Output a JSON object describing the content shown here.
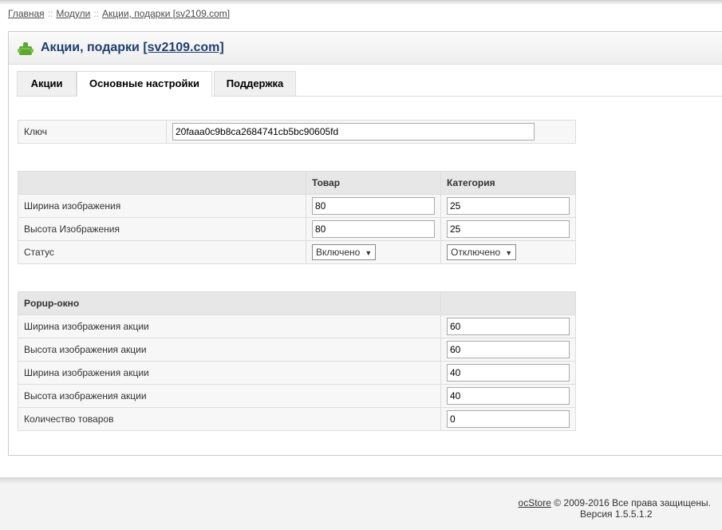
{
  "breadcrumb": {
    "items": [
      "Главная",
      "Модули",
      "Акции, подарки [sv2109.com]"
    ],
    "separator": "::"
  },
  "heading": {
    "title": "Акции, подарки",
    "link": "[sv2109.com]",
    "icon": "puzzle-module-icon"
  },
  "tabs": [
    {
      "label": "Акции",
      "active": false
    },
    {
      "label": "Основные настройки",
      "active": true
    },
    {
      "label": "Поддержка",
      "active": false
    }
  ],
  "key_table": {
    "label": "Ключ",
    "value": "20faaa0c9b8ca2684741cb5bc90605fd"
  },
  "image_table": {
    "headers": [
      "",
      "Товар",
      "Категория"
    ],
    "rows": [
      {
        "label": "Ширина изображения",
        "product": "80",
        "category": "25"
      },
      {
        "label": "Высота Изображения",
        "product": "80",
        "category": "25"
      }
    ],
    "status": {
      "label": "Статус",
      "product": "Включено",
      "category": "Отключено"
    }
  },
  "popup_table": {
    "header": "Popup-окно",
    "rows": [
      {
        "label": "Ширина изображения акции",
        "value": "60"
      },
      {
        "label": "Высота изображения акции",
        "value": "60"
      },
      {
        "label": "Ширина изображения акции",
        "value": "40"
      },
      {
        "label": "Высота изображения акции",
        "value": "40"
      },
      {
        "label": "Количество товаров",
        "value": "0"
      }
    ]
  },
  "footer": {
    "brand": "ocStore",
    "copyright": "© 2009-2016 Все права защищены.",
    "version": "Версия 1.5.5.1.2"
  },
  "colors": {
    "title": "#1f3f70",
    "icon_green": "#5aa830"
  }
}
